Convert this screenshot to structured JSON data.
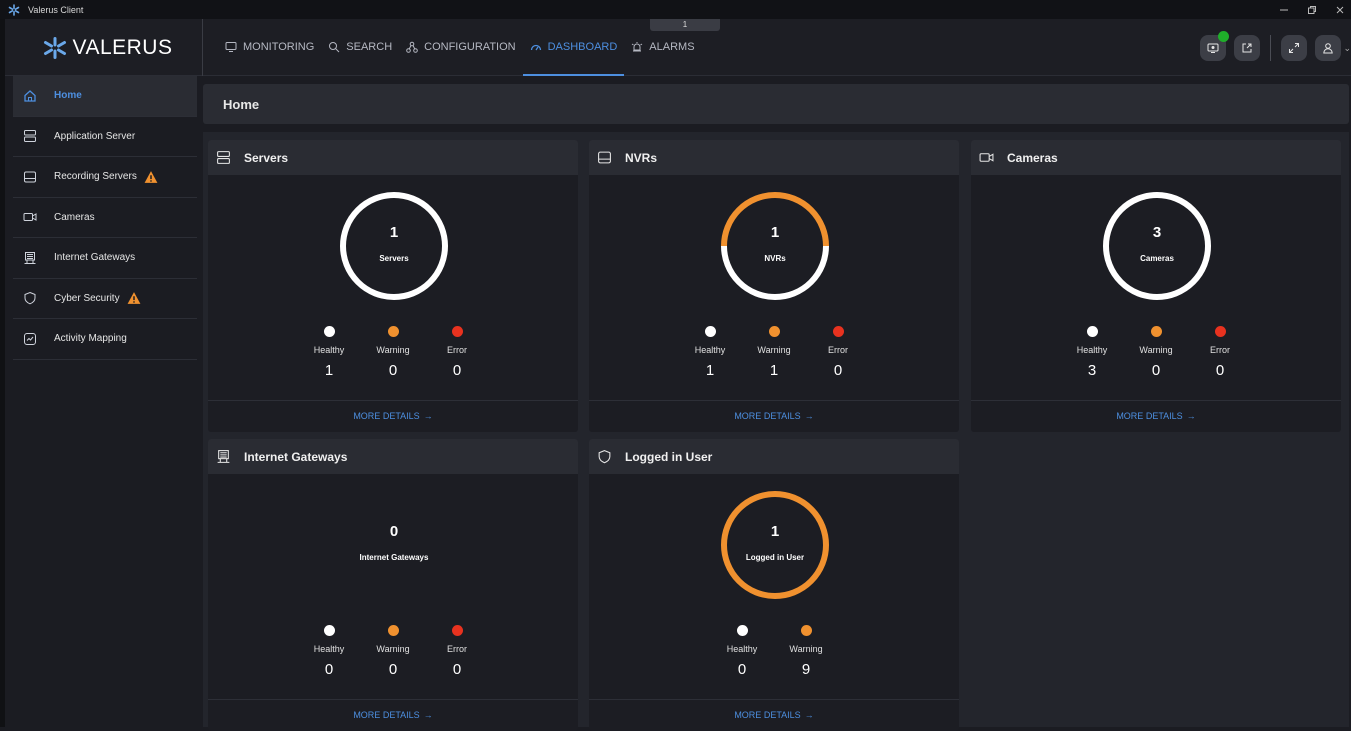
{
  "window": {
    "title": "Valerus Client",
    "controls": [
      "minimize",
      "restore",
      "close"
    ]
  },
  "brand": {
    "logo_text": "VALERUS",
    "accent": "#4d8fe0"
  },
  "nav": {
    "items": [
      {
        "label": "MONITORING",
        "icon": "monitor-icon"
      },
      {
        "label": "SEARCH",
        "icon": "search-icon"
      },
      {
        "label": "CONFIGURATION",
        "icon": "configuration-icon"
      },
      {
        "label": "DASHBOARD",
        "icon": "dashboard-icon",
        "active": true
      },
      {
        "label": "ALARMS",
        "icon": "alarm-icon"
      }
    ],
    "page_indicator": "1"
  },
  "sidebar": {
    "items": [
      {
        "label": "Home",
        "icon": "home-icon",
        "active": true
      },
      {
        "label": "Application Server",
        "icon": "server-icon"
      },
      {
        "label": "Recording Servers",
        "icon": "recording-server-icon",
        "warning": true
      },
      {
        "label": "Cameras",
        "icon": "camera-icon"
      },
      {
        "label": "Internet Gateways",
        "icon": "gateway-icon"
      },
      {
        "label": "Cyber Security",
        "icon": "shield-icon",
        "warning": true
      },
      {
        "label": "Activity Mapping",
        "icon": "activity-icon"
      }
    ]
  },
  "page": {
    "title": "Home"
  },
  "status_colors": {
    "healthy": "#ffffff",
    "warning": "#f0912f",
    "error": "#e8321f"
  },
  "cards": {
    "servers": {
      "title": "Servers",
      "count": "1",
      "ring_label": "Servers",
      "healthy_label": "Healthy",
      "warning_label": "Warning",
      "error_label": "Error",
      "healthy": "1",
      "warning": "0",
      "error": "0",
      "more": "MORE DETAILS"
    },
    "nvrs": {
      "title": "NVRs",
      "count": "1",
      "ring_label": "NVRs",
      "healthy_label": "Healthy",
      "warning_label": "Warning",
      "error_label": "Error",
      "healthy": "1",
      "warning": "1",
      "error": "0",
      "more": "MORE DETAILS"
    },
    "cameras": {
      "title": "Cameras",
      "count": "3",
      "ring_label": "Cameras",
      "healthy_label": "Healthy",
      "warning_label": "Warning",
      "error_label": "Error",
      "healthy": "3",
      "warning": "0",
      "error": "0",
      "more": "MORE DETAILS"
    },
    "gateways": {
      "title": "Internet Gateways",
      "count": "0",
      "ring_label": "Internet Gateways",
      "healthy_label": "Healthy",
      "warning_label": "Warning",
      "error_label": "Error",
      "healthy": "0",
      "warning": "0",
      "error": "0",
      "more": "MORE DETAILS"
    },
    "users": {
      "title": "Logged in User",
      "count": "1",
      "ring_label": "Logged in User",
      "healthy_label": "Healthy",
      "warning_label": "Warning",
      "healthy": "0",
      "warning": "9",
      "more": "MORE DETAILS"
    }
  }
}
